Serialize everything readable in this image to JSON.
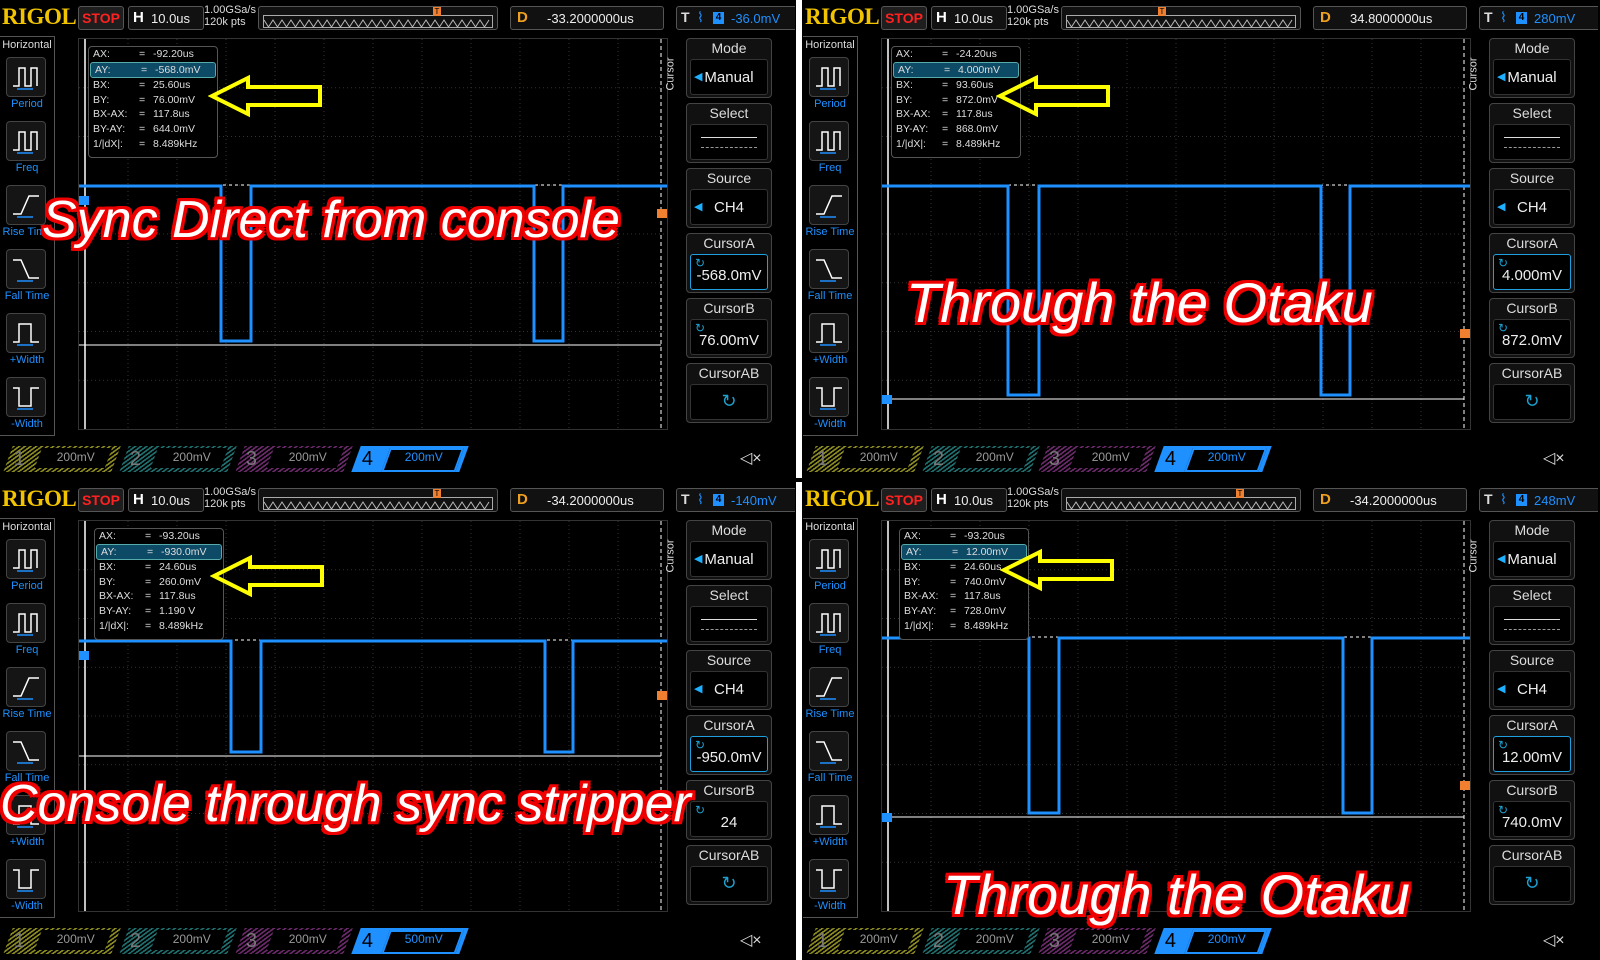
{
  "colors": {
    "brand": "#f2c400",
    "stop": "#ff2020",
    "ch4": "#1e90ff",
    "ch1": "#8a8a20",
    "ch2": "#1f6f6f",
    "ch3": "#6a2a6a",
    "delay": "#f0a020",
    "trigger_marker": "#f08030",
    "caption_outline": "#e00000",
    "caption_fill": "#ffffff",
    "arrow": "#ffff00"
  },
  "panels": [
    {
      "caption": "Sync Direct from console",
      "header": {
        "logo": "RIGOL",
        "run_state": "STOP",
        "h_label": "H",
        "timebase": "10.0us",
        "sample_rate": "1.00GSa/s",
        "mem_depth": "120k pts",
        "d_label": "D",
        "delay": "-33.2000000us",
        "t_label": "T",
        "trig_source": "4",
        "trig_level": "-36.0mV"
      },
      "measure": {
        "title": "Horizontal",
        "items": [
          "Period",
          "Freq",
          "Rise Time",
          "Fall Time",
          "+Width",
          "-Width"
        ]
      },
      "cursor_table": [
        {
          "k": "AX:",
          "v": "-92.20us"
        },
        {
          "k": "AY:",
          "v": "-568.0mV",
          "selected": true
        },
        {
          "k": "BX:",
          "v": "25.60us"
        },
        {
          "k": "BY:",
          "v": "76.00mV"
        },
        {
          "k": "BX-AX:",
          "v": "117.8us"
        },
        {
          "k": "BY-AY:",
          "v": "644.0mV"
        },
        {
          "k": "1/|dX|:",
          "v": "8.489kHz"
        }
      ],
      "menu": {
        "tab": "Cursor",
        "mode_label": "Mode",
        "mode_value": "Manual",
        "select_label": "Select",
        "source_label": "Source",
        "source_value": "CH4",
        "cursor_a_label": "CursorA",
        "cursor_a_value": "-568.0mV",
        "cursor_b_label": "CursorB",
        "cursor_b_value": "76.00mV",
        "cursor_ab_label": "CursorAB"
      },
      "channels": [
        {
          "n": "1",
          "scale": "200mV"
        },
        {
          "n": "2",
          "scale": "200mV"
        },
        {
          "n": "3",
          "scale": "200mV"
        },
        {
          "n": "4",
          "scale": "200mV",
          "active": true
        }
      ],
      "ch_marker": "4"
    },
    {
      "caption": "Through the Otaku",
      "header": {
        "logo": "RIGOL",
        "run_state": "STOP",
        "h_label": "H",
        "timebase": "10.0us",
        "sample_rate": "1.00GSa/s",
        "mem_depth": "120k pts",
        "d_label": "D",
        "delay": "34.8000000us",
        "t_label": "T",
        "trig_source": "4",
        "trig_level": "280mV"
      },
      "measure": {
        "title": "Horizontal",
        "items": [
          "Period",
          "Freq",
          "Rise Time",
          "Fall Time",
          "+Width",
          "-Width"
        ]
      },
      "cursor_table": [
        {
          "k": "AX:",
          "v": "-24.20us"
        },
        {
          "k": "AY:",
          "v": "4.000mV",
          "selected": true
        },
        {
          "k": "BX:",
          "v": "93.60us"
        },
        {
          "k": "BY:",
          "v": "872.0mV"
        },
        {
          "k": "BX-AX:",
          "v": "117.8us"
        },
        {
          "k": "BY-AY:",
          "v": "868.0mV"
        },
        {
          "k": "1/|dX|:",
          "v": "8.489kHz"
        }
      ],
      "menu": {
        "tab": "Cursor",
        "mode_label": "Mode",
        "mode_value": "Manual",
        "select_label": "Select",
        "source_label": "Source",
        "source_value": "CH4",
        "cursor_a_label": "CursorA",
        "cursor_a_value": "4.000mV",
        "cursor_b_label": "CursorB",
        "cursor_b_value": "872.0mV",
        "cursor_ab_label": "CursorAB"
      },
      "channels": [
        {
          "n": "1",
          "scale": "200mV"
        },
        {
          "n": "2",
          "scale": "200mV"
        },
        {
          "n": "3",
          "scale": "200mV"
        },
        {
          "n": "4",
          "scale": "200mV",
          "active": true
        }
      ],
      "ch_marker": "4"
    },
    {
      "caption": "Console through sync stripper",
      "header": {
        "logo": "RIGOL",
        "run_state": "STOP",
        "h_label": "H",
        "timebase": "10.0us",
        "sample_rate": "1.00GSa/s",
        "mem_depth": "120k pts",
        "d_label": "D",
        "delay": "-34.2000000us",
        "t_label": "T",
        "trig_source": "4",
        "trig_level": "-140mV"
      },
      "measure": {
        "title": "Horizontal",
        "items": [
          "Period",
          "Freq",
          "Rise Time",
          "Fall Time",
          "+Width",
          "-Width"
        ]
      },
      "cursor_table": [
        {
          "k": "AX:",
          "v": "-93.20us"
        },
        {
          "k": "AY:",
          "v": "-930.0mV",
          "selected": true
        },
        {
          "k": "BX:",
          "v": "24.60us"
        },
        {
          "k": "BY:",
          "v": "260.0mV"
        },
        {
          "k": "BX-AX:",
          "v": "117.8us"
        },
        {
          "k": "BY-AY:",
          "v": "1.190 V"
        },
        {
          "k": "1/|dX|:",
          "v": "8.489kHz"
        }
      ],
      "menu": {
        "tab": "Cursor",
        "mode_label": "Mode",
        "mode_value": "Manual",
        "select_label": "Select",
        "source_label": "Source",
        "source_value": "CH4",
        "cursor_a_label": "CursorA",
        "cursor_a_value": "-950.0mV",
        "cursor_b_label": "CursorB",
        "cursor_b_value": "24",
        "cursor_ab_label": "CursorAB"
      },
      "channels": [
        {
          "n": "1",
          "scale": "200mV"
        },
        {
          "n": "2",
          "scale": "200mV"
        },
        {
          "n": "3",
          "scale": "200mV"
        },
        {
          "n": "4",
          "scale": "500mV",
          "active": true
        }
      ],
      "ch_marker": "4"
    },
    {
      "caption": "Through the Otaku",
      "header": {
        "logo": "RIGOL",
        "run_state": "STOP",
        "h_label": "H",
        "timebase": "10.0us",
        "sample_rate": "1.00GSa/s",
        "mem_depth": "120k pts",
        "d_label": "D",
        "delay": "-34.2000000us",
        "t_label": "T",
        "trig_source": "4",
        "trig_level": "248mV"
      },
      "measure": {
        "title": "Horizontal",
        "items": [
          "Period",
          "Freq",
          "Rise Time",
          "Fall Time",
          "+Width",
          "-Width"
        ]
      },
      "cursor_table": [
        {
          "k": "AX:",
          "v": "-93.20us"
        },
        {
          "k": "AY:",
          "v": "12.00mV",
          "selected": true
        },
        {
          "k": "BX:",
          "v": "24.60us"
        },
        {
          "k": "BY:",
          "v": "740.0mV"
        },
        {
          "k": "BX-AX:",
          "v": "117.8us"
        },
        {
          "k": "BY-AY:",
          "v": "728.0mV"
        },
        {
          "k": "1/|dX|:",
          "v": "8.489kHz"
        }
      ],
      "menu": {
        "tab": "Cursor",
        "mode_label": "Mode",
        "mode_value": "Manual",
        "select_label": "Select",
        "source_label": "Source",
        "source_value": "CH4",
        "cursor_a_label": "CursorA",
        "cursor_a_value": "12.00mV",
        "cursor_b_label": "CursorB",
        "cursor_b_value": "740.0mV",
        "cursor_ab_label": "CursorAB"
      },
      "channels": [
        {
          "n": "1",
          "scale": "200mV"
        },
        {
          "n": "2",
          "scale": "200mV"
        },
        {
          "n": "3",
          "scale": "200mV"
        },
        {
          "n": "4",
          "scale": "200mV",
          "active": true
        }
      ],
      "ch_marker": "4"
    }
  ]
}
